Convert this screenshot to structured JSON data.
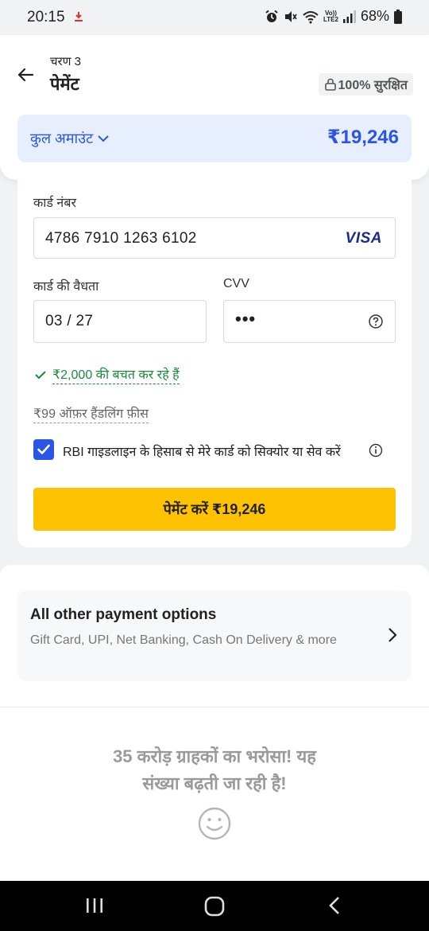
{
  "status_bar": {
    "time": "20:15",
    "volte_top": "Vo))",
    "volte_bottom": "LTE2",
    "battery": "68%"
  },
  "header": {
    "step": "चरण 3",
    "title": "पेमेंट",
    "secure_badge": "100% सुरक्षित",
    "total_label": "कुल अमाउंट",
    "total_value": "₹19,246"
  },
  "card_form": {
    "card_number_label": "कार्ड नंबर",
    "card_number": "4786 7910 1263 6102",
    "card_brand": "VISA",
    "expiry_label": "कार्ड की वैधता",
    "expiry_value": "03 / 27",
    "cvv_label": "CVV",
    "cvv_value": "•••",
    "savings_text": "₹2,000 की बचत कर रहे हैं",
    "offer_text": "₹99 ऑफ़र हैंडलिंग फ़ीस",
    "save_card_checked": true,
    "save_card_text": "RBI गाइडलाइन के हिसाब से मेरे कार्ड को सिक्योर या सेव करें",
    "pay_button": "पेमेंट करें ₹19,246"
  },
  "other_options": {
    "title": "All other payment options",
    "subtitle": "Gift Card, UPI, Net Banking, Cash On Delivery & more"
  },
  "trust": {
    "line1": "35 करोड़ ग्राहकों का भरोसा! यह",
    "line2": "संख्या बढ़ती जा रही है!"
  },
  "colors": {
    "accent_blue": "#2a55e5",
    "pay_yellow": "#ffc200",
    "savings_green": "#1b8a3f"
  },
  "icons": [
    "back-arrow-icon",
    "lock-icon",
    "chevron-down-icon",
    "visa-icon",
    "help-icon",
    "check-icon",
    "checkbox-icon",
    "info-icon",
    "chevron-right-icon",
    "smiley-icon"
  ]
}
